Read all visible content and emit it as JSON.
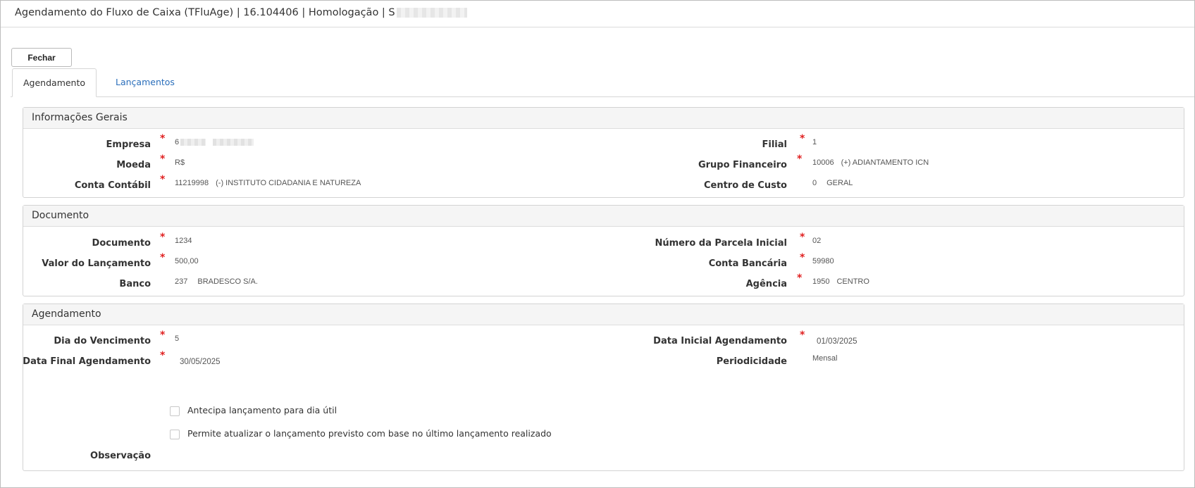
{
  "window": {
    "title": "Agendamento do Fluxo de Caixa (TFluAge) | 16.104406 | Homologação | S"
  },
  "toolbar": {
    "close_label": "Fechar"
  },
  "tabs": [
    {
      "label": "Agendamento",
      "active": true
    },
    {
      "label": "Lançamentos",
      "active": false
    }
  ],
  "sections": {
    "general": {
      "title": "Informações Gerais",
      "empresa_label": "Empresa",
      "empresa_value": "6",
      "filial_label": "Filial",
      "filial_value": "1",
      "moeda_label": "Moeda",
      "moeda_value": "R$",
      "grupo_label": "Grupo Financeiro",
      "grupo_code": "10006",
      "grupo_desc": "(+) ADIANTAMENTO ICN",
      "conta_label": "Conta Contábil",
      "conta_code": "11219998",
      "conta_desc": "(-) INSTITUTO CIDADANIA E NATUREZA",
      "centro_label": "Centro de Custo",
      "centro_code": "0",
      "centro_desc": "GERAL"
    },
    "document": {
      "title": "Documento",
      "doc_label": "Documento",
      "doc_value": "1234",
      "parcela_label": "Número da Parcela Inicial",
      "parcela_value": "02",
      "valor_label": "Valor do Lançamento",
      "valor_value": "500,00",
      "conta_bancaria_label": "Conta Bancária",
      "conta_bancaria_value": "59980",
      "banco_label": "Banco",
      "banco_code": "237",
      "banco_desc": "BRADESCO S/A.",
      "agencia_label": "Agência",
      "agencia_code": "1950",
      "agencia_desc": "CENTRO"
    },
    "schedule": {
      "title": "Agendamento",
      "dia_label": "Dia do Vencimento",
      "dia_value": "5",
      "data_inicial_label": "Data Inicial Agendamento",
      "data_inicial_value": "01/03/2025",
      "data_final_label": "Data Final Agendamento",
      "data_final_value": "30/05/2025",
      "periodicidade_label": "Periodicidade",
      "periodicidade_value": "Mensal",
      "checkbox_antecipa": "Antecipa lançamento para dia útil",
      "checkbox_atualizar": "Permite atualizar o lançamento previsto com base no último lançamento realizado",
      "observacao_label": "Observação"
    }
  },
  "colors": {
    "required": "#e02020",
    "link": "#2a6ebb",
    "panel_header": "#f5f5f5"
  }
}
